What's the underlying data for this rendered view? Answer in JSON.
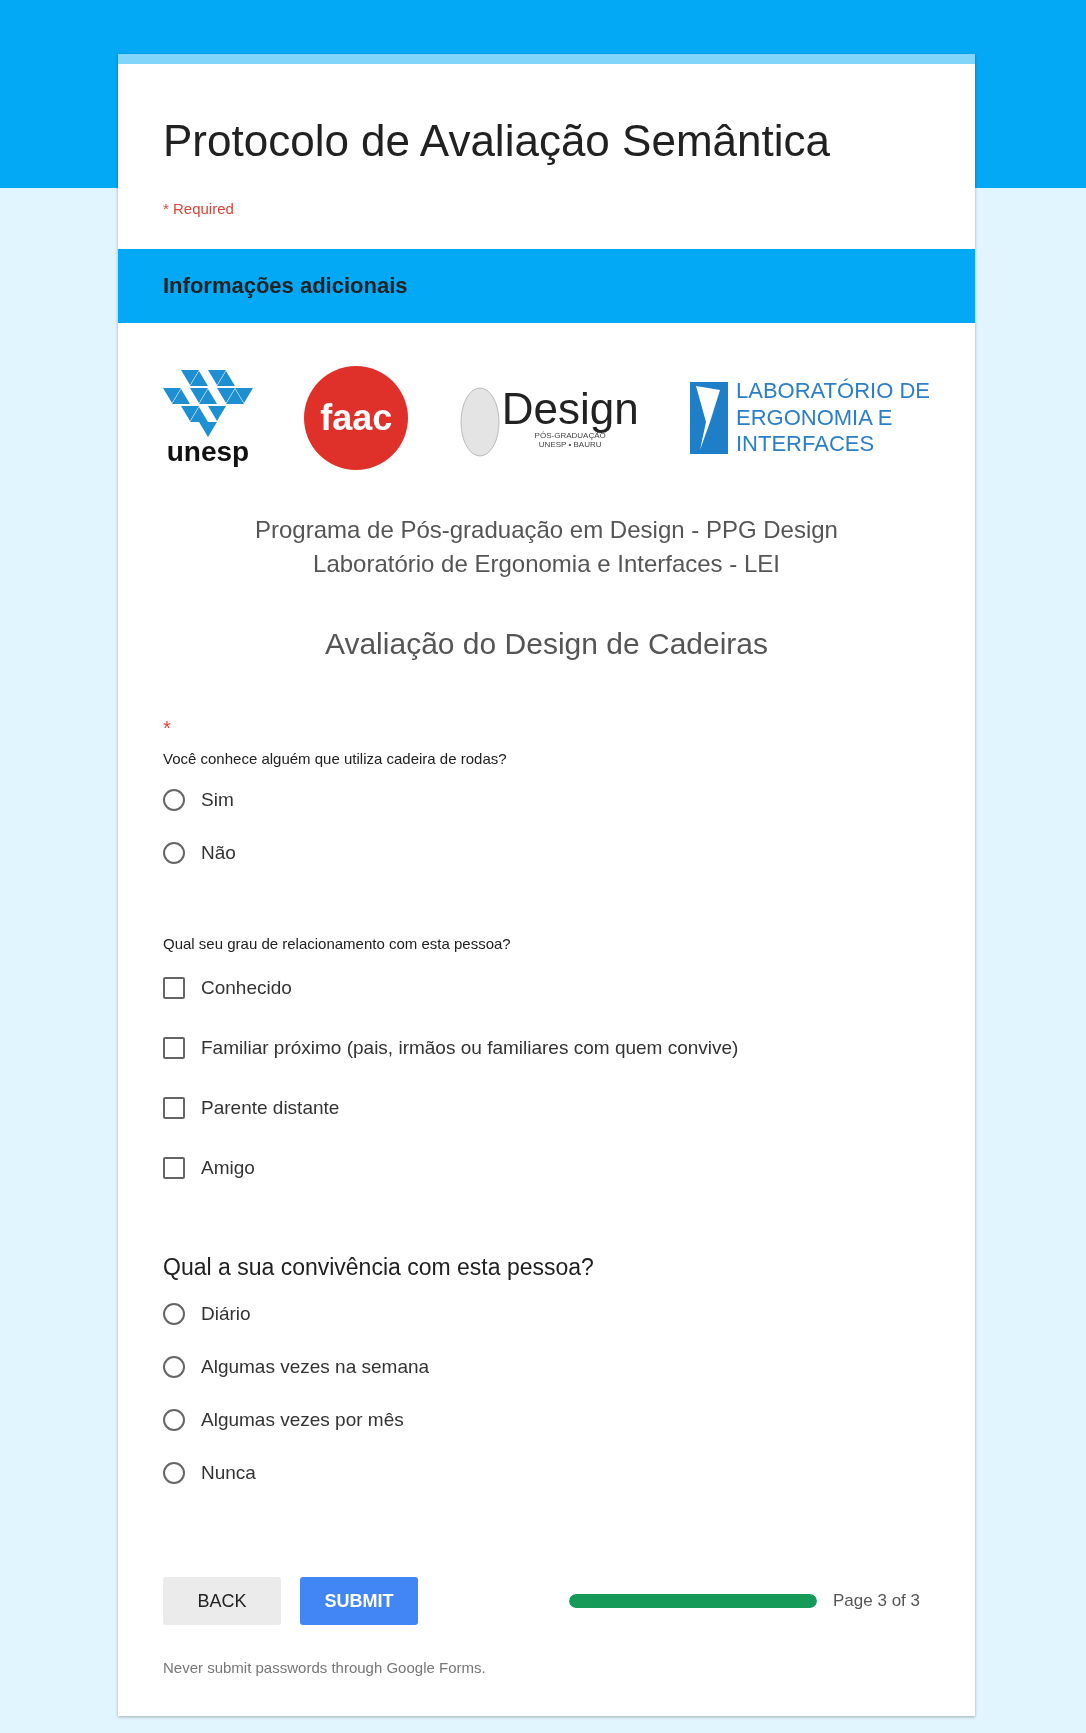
{
  "form": {
    "title": "Protocolo de Avaliação Semântica",
    "required_note": "* Required"
  },
  "section": {
    "title": "Informações adicionais"
  },
  "header_image": {
    "logos": [
      {
        "kind": "unesp",
        "text": "unesp"
      },
      {
        "kind": "faac",
        "text": "faac"
      },
      {
        "kind": "design",
        "text": "Design",
        "subtext": [
          "PÓS-GRADUAÇÃO",
          "UNESP • BAURU"
        ]
      },
      {
        "kind": "lab",
        "lines": [
          "LABORATÓRIO DE",
          "ERGONOMIA  E",
          "INTERFACES"
        ]
      }
    ],
    "lines": [
      "Programa  de Pós-graduação em Design - PPG Design",
      "Laboratório de Ergonomia e Interfaces - LEI"
    ],
    "subtitle": "Avaliação do Design de Cadeiras"
  },
  "questions": [
    {
      "kind": "radio",
      "required_mark": "*",
      "prominent": false,
      "text": "Você conhece alguém que utiliza cadeira de rodas?",
      "options": [
        {
          "label": "Sim",
          "selected": false
        },
        {
          "label": "Não",
          "selected": false
        }
      ]
    },
    {
      "kind": "checkbox",
      "prominent": false,
      "text": "Qual seu grau de relacionamento com esta pessoa?",
      "options": [
        {
          "label": "Conhecido",
          "checked": false
        },
        {
          "label": "Familiar próximo (pais, irmãos ou familiares com quem convive)",
          "checked": false
        },
        {
          "label": "Parente distante",
          "checked": false
        },
        {
          "label": "Amigo",
          "checked": false
        }
      ]
    },
    {
      "kind": "radio",
      "prominent": true,
      "text": "Qual a sua convivência com esta pessoa?",
      "options": [
        {
          "label": "Diário",
          "selected": false
        },
        {
          "label": "Algumas vezes na semana",
          "selected": false
        },
        {
          "label": "Algumas vezes por mês",
          "selected": false
        },
        {
          "label": "Nunca",
          "selected": false
        }
      ]
    }
  ],
  "buttons": {
    "back": "BACK",
    "submit": "SUBMIT"
  },
  "progress": {
    "level": 1,
    "label": "Page 3 of 3"
  },
  "footer": "Never submit passwords through Google Forms."
}
